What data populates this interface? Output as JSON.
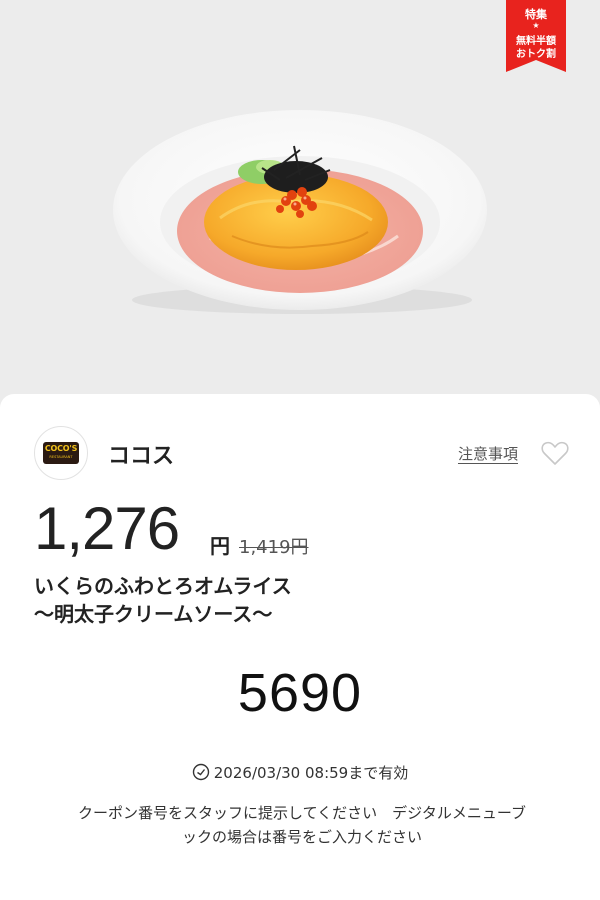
{
  "badge": {
    "top": "特集",
    "line1": "無料半額",
    "line2": "おトク割",
    "color": "#e8231e"
  },
  "shop": {
    "logo_text": "COCO'S",
    "logo_subtext": "RESTAURANT",
    "name": "ココス"
  },
  "links": {
    "notes_label": "注意事項"
  },
  "icons": {
    "favorite": "heart-outline-icon",
    "clock": "clock-icon"
  },
  "offer": {
    "price": "1,276",
    "price_unit": "円",
    "original_price": "1,419円",
    "item_name_line1": "いくらのふわとろオムライス",
    "item_name_line2": "〜明太子クリームソース〜"
  },
  "coupon": {
    "code": "5690",
    "validity": "2026/03/30 08:59まで有効",
    "instruction_line1": "クーポン番号をスタッフに提示してください　デジタルメニューブ",
    "instruction_line2": "ックの場合は番号をご入力ください"
  }
}
